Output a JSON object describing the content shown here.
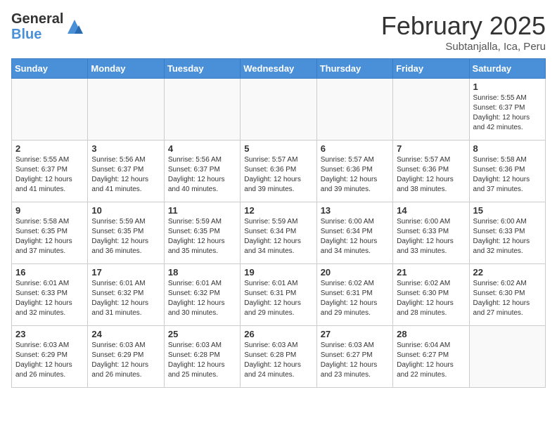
{
  "header": {
    "logo_general": "General",
    "logo_blue": "Blue",
    "month_title": "February 2025",
    "subtitle": "Subtanjalla, Ica, Peru"
  },
  "weekdays": [
    "Sunday",
    "Monday",
    "Tuesday",
    "Wednesday",
    "Thursday",
    "Friday",
    "Saturday"
  ],
  "weeks": [
    [
      {
        "day": "",
        "info": ""
      },
      {
        "day": "",
        "info": ""
      },
      {
        "day": "",
        "info": ""
      },
      {
        "day": "",
        "info": ""
      },
      {
        "day": "",
        "info": ""
      },
      {
        "day": "",
        "info": ""
      },
      {
        "day": "1",
        "info": "Sunrise: 5:55 AM\nSunset: 6:37 PM\nDaylight: 12 hours\nand 42 minutes."
      }
    ],
    [
      {
        "day": "2",
        "info": "Sunrise: 5:55 AM\nSunset: 6:37 PM\nDaylight: 12 hours\nand 41 minutes."
      },
      {
        "day": "3",
        "info": "Sunrise: 5:56 AM\nSunset: 6:37 PM\nDaylight: 12 hours\nand 41 minutes."
      },
      {
        "day": "4",
        "info": "Sunrise: 5:56 AM\nSunset: 6:37 PM\nDaylight: 12 hours\nand 40 minutes."
      },
      {
        "day": "5",
        "info": "Sunrise: 5:57 AM\nSunset: 6:36 PM\nDaylight: 12 hours\nand 39 minutes."
      },
      {
        "day": "6",
        "info": "Sunrise: 5:57 AM\nSunset: 6:36 PM\nDaylight: 12 hours\nand 39 minutes."
      },
      {
        "day": "7",
        "info": "Sunrise: 5:57 AM\nSunset: 6:36 PM\nDaylight: 12 hours\nand 38 minutes."
      },
      {
        "day": "8",
        "info": "Sunrise: 5:58 AM\nSunset: 6:36 PM\nDaylight: 12 hours\nand 37 minutes."
      }
    ],
    [
      {
        "day": "9",
        "info": "Sunrise: 5:58 AM\nSunset: 6:35 PM\nDaylight: 12 hours\nand 37 minutes."
      },
      {
        "day": "10",
        "info": "Sunrise: 5:59 AM\nSunset: 6:35 PM\nDaylight: 12 hours\nand 36 minutes."
      },
      {
        "day": "11",
        "info": "Sunrise: 5:59 AM\nSunset: 6:35 PM\nDaylight: 12 hours\nand 35 minutes."
      },
      {
        "day": "12",
        "info": "Sunrise: 5:59 AM\nSunset: 6:34 PM\nDaylight: 12 hours\nand 34 minutes."
      },
      {
        "day": "13",
        "info": "Sunrise: 6:00 AM\nSunset: 6:34 PM\nDaylight: 12 hours\nand 34 minutes."
      },
      {
        "day": "14",
        "info": "Sunrise: 6:00 AM\nSunset: 6:33 PM\nDaylight: 12 hours\nand 33 minutes."
      },
      {
        "day": "15",
        "info": "Sunrise: 6:00 AM\nSunset: 6:33 PM\nDaylight: 12 hours\nand 32 minutes."
      }
    ],
    [
      {
        "day": "16",
        "info": "Sunrise: 6:01 AM\nSunset: 6:33 PM\nDaylight: 12 hours\nand 32 minutes."
      },
      {
        "day": "17",
        "info": "Sunrise: 6:01 AM\nSunset: 6:32 PM\nDaylight: 12 hours\nand 31 minutes."
      },
      {
        "day": "18",
        "info": "Sunrise: 6:01 AM\nSunset: 6:32 PM\nDaylight: 12 hours\nand 30 minutes."
      },
      {
        "day": "19",
        "info": "Sunrise: 6:01 AM\nSunset: 6:31 PM\nDaylight: 12 hours\nand 29 minutes."
      },
      {
        "day": "20",
        "info": "Sunrise: 6:02 AM\nSunset: 6:31 PM\nDaylight: 12 hours\nand 29 minutes."
      },
      {
        "day": "21",
        "info": "Sunrise: 6:02 AM\nSunset: 6:30 PM\nDaylight: 12 hours\nand 28 minutes."
      },
      {
        "day": "22",
        "info": "Sunrise: 6:02 AM\nSunset: 6:30 PM\nDaylight: 12 hours\nand 27 minutes."
      }
    ],
    [
      {
        "day": "23",
        "info": "Sunrise: 6:03 AM\nSunset: 6:29 PM\nDaylight: 12 hours\nand 26 minutes."
      },
      {
        "day": "24",
        "info": "Sunrise: 6:03 AM\nSunset: 6:29 PM\nDaylight: 12 hours\nand 26 minutes."
      },
      {
        "day": "25",
        "info": "Sunrise: 6:03 AM\nSunset: 6:28 PM\nDaylight: 12 hours\nand 25 minutes."
      },
      {
        "day": "26",
        "info": "Sunrise: 6:03 AM\nSunset: 6:28 PM\nDaylight: 12 hours\nand 24 minutes."
      },
      {
        "day": "27",
        "info": "Sunrise: 6:03 AM\nSunset: 6:27 PM\nDaylight: 12 hours\nand 23 minutes."
      },
      {
        "day": "28",
        "info": "Sunrise: 6:04 AM\nSunset: 6:27 PM\nDaylight: 12 hours\nand 22 minutes."
      },
      {
        "day": "",
        "info": ""
      }
    ]
  ]
}
